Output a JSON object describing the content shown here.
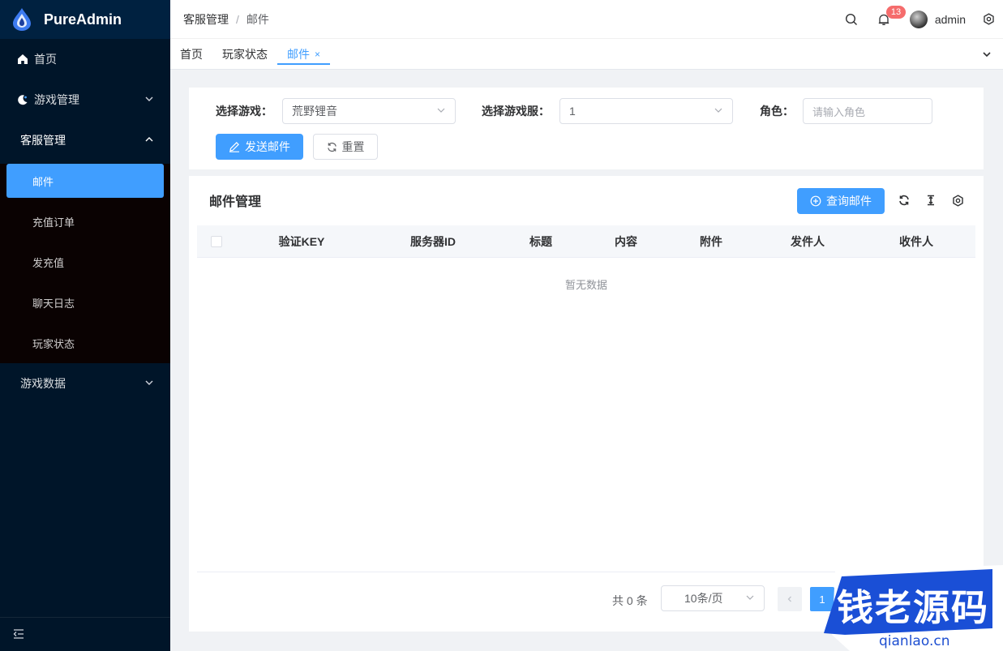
{
  "app": {
    "name": "PureAdmin"
  },
  "sidebar": {
    "items": [
      {
        "label": "首页"
      },
      {
        "label": "游戏管理"
      },
      {
        "label": "客服管理"
      },
      {
        "label": "游戏数据"
      }
    ],
    "submenu": [
      {
        "label": "邮件",
        "active": true
      },
      {
        "label": "充值订单"
      },
      {
        "label": "发充值"
      },
      {
        "label": "聊天日志"
      },
      {
        "label": "玩家状态"
      }
    ]
  },
  "header": {
    "breadcrumb": [
      "客服管理",
      "邮件"
    ],
    "notification_count": "13",
    "username": "admin"
  },
  "tabs": [
    {
      "label": "首页"
    },
    {
      "label": "玩家状态"
    },
    {
      "label": "邮件",
      "active": true,
      "close": "×"
    }
  ],
  "search_form": {
    "game_label": "选择游戏：",
    "game_value": "荒野锂音",
    "server_label": "选择游戏服：",
    "server_value": "1",
    "role_label": "角色：",
    "role_placeholder": "请输入角色",
    "send_button": "发送邮件",
    "reset_button": "重置"
  },
  "table": {
    "title": "邮件管理",
    "query_button": "查询邮件",
    "columns": [
      "验证KEY",
      "服务器ID",
      "标题",
      "内容",
      "附件",
      "发件人",
      "收件人"
    ],
    "rows": [],
    "empty_text": "暂无数据"
  },
  "pagination": {
    "total_text": "共 0 条",
    "page_size": "10条/页",
    "current_page": "1"
  },
  "watermark": {
    "text": "钱老源码",
    "url": "qianlao.cn"
  },
  "colors": {
    "primary": "#409eff",
    "sidebar_bg": "#001529",
    "badge": "#f56c6c"
  }
}
